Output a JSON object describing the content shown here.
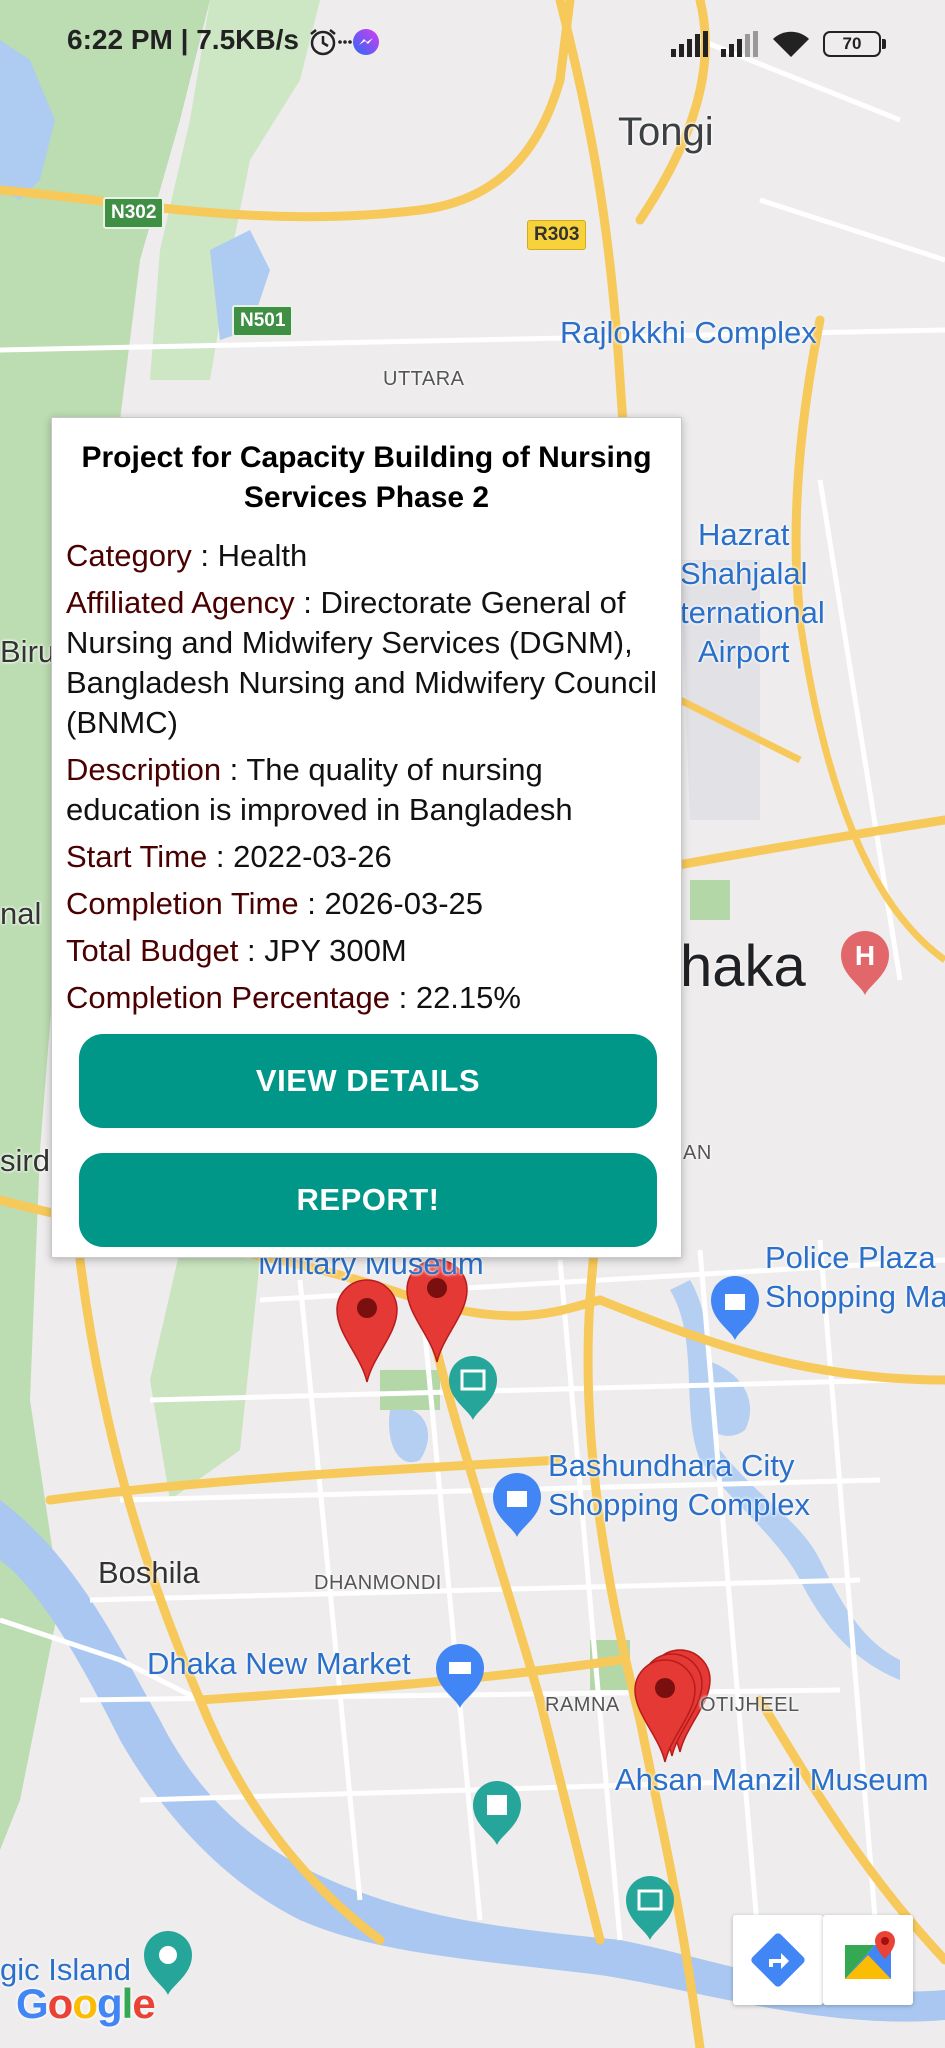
{
  "status_bar": {
    "time": "6:22 PM | 7.5KB/s",
    "battery": "70"
  },
  "map": {
    "labels": {
      "tongi": "Tongi",
      "rajlokkhi": "Rajlokkhi Complex",
      "uttara": "UTTARA",
      "hazrat_1": "Hazrat",
      "hazrat_2": "Shahjalal",
      "hazrat_3": "ternational",
      "hazrat_4": "Airport",
      "biru": "Biru",
      "nal": "nal",
      "dhaka": "haka",
      "sird": "sird",
      "an": "AN",
      "military_museum": "Military Museum",
      "police_plaza_1": "Police Plaza",
      "police_plaza_2": "Shopping Ma",
      "bashundhara_1": "Bashundhara City",
      "bashundhara_2": "Shopping Complex",
      "boshila": "Boshila",
      "dhanmondi": "DHANMONDI",
      "new_market": "Dhaka New Market",
      "ramna": "RAMNA",
      "motijheel": "OTIJHEEL",
      "ahsan_manzil": "Ahsan Manzil Museum",
      "magic_island": "gic Island"
    },
    "shields": {
      "n302": "N302",
      "n501": "N501",
      "r303": "R303"
    },
    "hospital_symbol": "H",
    "google_logo": "Google"
  },
  "popup": {
    "title": "Project for Capacity Building of Nursing Services Phase 2",
    "fields": [
      {
        "label": "Category",
        "value": "Health"
      },
      {
        "label": "Affiliated Agency",
        "value": "Directorate General of Nursing and Midwifery Services (DGNM), Bangladesh Nursing and Midwifery Council (BNMC)"
      },
      {
        "label": "Description",
        "value": "The quality of nursing education is improved in Bangladesh"
      },
      {
        "label": "Start Time",
        "value": "2022-03-26"
      },
      {
        "label": "Completion Time",
        "value": "2026-03-25"
      },
      {
        "label": "Total Budget",
        "value": "JPY 300M"
      },
      {
        "label": "Completion Percentage",
        "value": "22.15%"
      }
    ],
    "separator": " : ",
    "view_details_label": "VIEW DETAILS",
    "report_label": "REPORT!"
  },
  "colors": {
    "button": "#009688",
    "label": "#4a0000",
    "marker": "#e53935",
    "road": "#f7c95a",
    "water": "#a8c8f0",
    "park": "#b4d7a8"
  },
  "icons": {
    "directions_fab": "directions-icon",
    "maps_fab": "google-maps-icon"
  }
}
